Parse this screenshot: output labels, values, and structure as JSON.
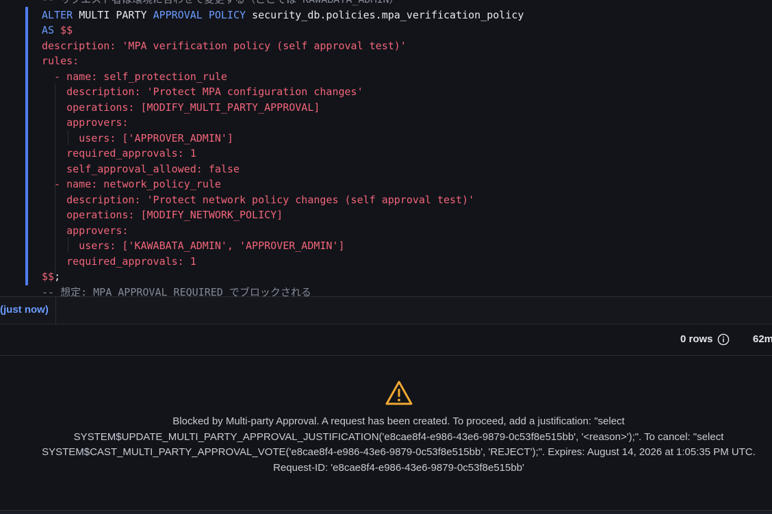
{
  "editor": {
    "lines": [
      [
        {
          "t": "comment",
          "v": "-- リクエスト者は環境に合わせて変更する（ここでは KAWABATA_ADMIN）"
        }
      ],
      [
        {
          "t": "kw",
          "v": "ALTER "
        },
        {
          "t": "id",
          "v": "MULTI PARTY "
        },
        {
          "t": "kw",
          "v": "APPROVAL POLICY "
        },
        {
          "t": "id",
          "v": "security_db.policies.mpa_verification_policy"
        }
      ],
      [
        {
          "t": "kw",
          "v": "AS "
        },
        {
          "t": "str",
          "v": "$$"
        }
      ],
      [
        {
          "t": "str",
          "v": "description: 'MPA verification policy (self approval test)'"
        }
      ],
      [
        {
          "t": "str",
          "v": "rules:"
        }
      ],
      [
        {
          "t": "str",
          "v": "  - name: self_protection_rule"
        }
      ],
      [
        {
          "t": "str",
          "v": "    description: 'Protect MPA configuration changes'"
        }
      ],
      [
        {
          "t": "str",
          "v": "    operations: [MODIFY_MULTI_PARTY_APPROVAL]"
        }
      ],
      [
        {
          "t": "str",
          "v": "    approvers:"
        }
      ],
      [
        {
          "t": "str",
          "v": "      users: ['APPROVER_ADMIN']"
        }
      ],
      [
        {
          "t": "str",
          "v": "    required_approvals: 1"
        }
      ],
      [
        {
          "t": "str",
          "v": "    self_approval_allowed: false"
        }
      ],
      [
        {
          "t": "str",
          "v": "  - name: network_policy_rule"
        }
      ],
      [
        {
          "t": "str",
          "v": "    description: 'Protect network policy changes (self approval test)'"
        }
      ],
      [
        {
          "t": "str",
          "v": "    operations: [MODIFY_NETWORK_POLICY]"
        }
      ],
      [
        {
          "t": "str",
          "v": "    approvers:"
        }
      ],
      [
        {
          "t": "str",
          "v": "      users: ['KAWABATA_ADMIN', 'APPROVER_ADMIN']"
        }
      ],
      [
        {
          "t": "str",
          "v": "    required_approvals: 1"
        }
      ],
      [
        {
          "t": "str",
          "v": "$$"
        },
        {
          "t": "id",
          "v": ";"
        }
      ],
      [
        {
          "t": "comment",
          "v": "-- 想定: MPA_APPROVAL_REQUIRED でブロックされる"
        }
      ]
    ]
  },
  "results": {
    "tab_label": "(just now)",
    "rows_count": "0 rows",
    "duration": "62m"
  },
  "message": {
    "icon": "warning-triangle-icon",
    "text": "Blocked by Multi-party Approval. A request has been created. To proceed, add a justification: \"select SYSTEM$UPDATE_MULTI_PARTY_APPROVAL_JUSTIFICATION('e8cae8f4-e986-43e6-9879-0c53f8e515bb', '<reason>');\". To cancel: \"select SYSTEM$CAST_MULTI_PARTY_APPROVAL_VOTE('e8cae8f4-e986-43e6-9879-0c53f8e515bb', 'REJECT');\". Expires: August 14, 2026 at 1:05:35 PM UTC. Request-ID: 'e8cae8f4-e986-43e6-9879-0c53f8e515bb'"
  },
  "colors": {
    "keyword": "#6c9cff",
    "identifier": "#e8eaf0",
    "string": "#f2657a",
    "comment": "#858a98",
    "warning": "#f0a832",
    "active_line_bar": "#4f7cf2"
  }
}
